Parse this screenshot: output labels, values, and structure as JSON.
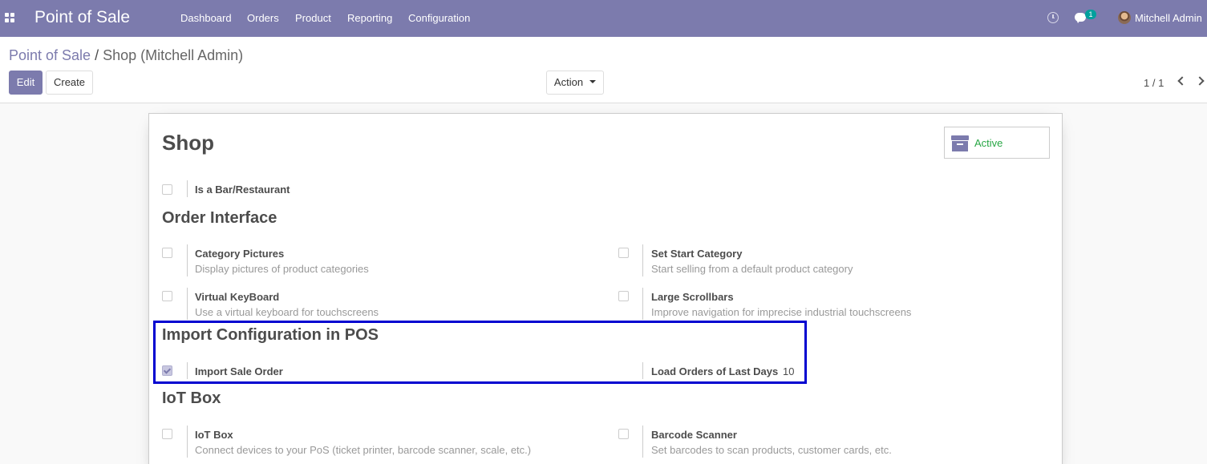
{
  "navbar": {
    "app_title": "Point of Sale",
    "menu": [
      {
        "label": "Dashboard"
      },
      {
        "label": "Orders"
      },
      {
        "label": "Product"
      },
      {
        "label": "Reporting"
      },
      {
        "label": "Configuration"
      }
    ],
    "messages_count": "1",
    "user_name": "Mitchell Admin",
    "brand_color": "#7c7bad"
  },
  "breadcrumb": {
    "parent": "Point of Sale",
    "separator": "/",
    "current": "Shop (Mitchell Admin)"
  },
  "buttons": {
    "edit": "Edit",
    "create": "Create",
    "action": "Action"
  },
  "pager": {
    "value": "1 / 1"
  },
  "form": {
    "title": "Shop",
    "active_label": "Active",
    "active_color": "#28a745",
    "is_bar_restaurant": {
      "label": "Is a Bar/Restaurant",
      "checked": false
    },
    "sections": {
      "order_interface": {
        "title": "Order Interface",
        "settings": [
          {
            "label": "Category Pictures",
            "help": "Display pictures of product categories",
            "checked": false
          },
          {
            "label": "Set Start Category",
            "help": "Start selling from a default product category",
            "checked": false
          },
          {
            "label": "Virtual KeyBoard",
            "help": "Use a virtual keyboard for touchscreens",
            "checked": false
          },
          {
            "label": "Large Scrollbars",
            "help": "Improve navigation for imprecise industrial touchscreens",
            "checked": false
          }
        ]
      },
      "import_config": {
        "title": "Import Configuration in POS",
        "import_sale_order": {
          "label": "Import Sale Order",
          "checked": true
        },
        "load_orders": {
          "label": "Load Orders of Last Days",
          "value": "10"
        }
      },
      "iot": {
        "title": "IoT Box",
        "settings": [
          {
            "label": "IoT Box",
            "help": "Connect devices to your PoS (ticket printer, barcode scanner, scale, etc.)",
            "checked": false
          },
          {
            "label": "Barcode Scanner",
            "help": "Set barcodes to scan products, customer cards, etc.",
            "checked": false
          }
        ]
      }
    }
  },
  "highlight_color": "#0000d0"
}
